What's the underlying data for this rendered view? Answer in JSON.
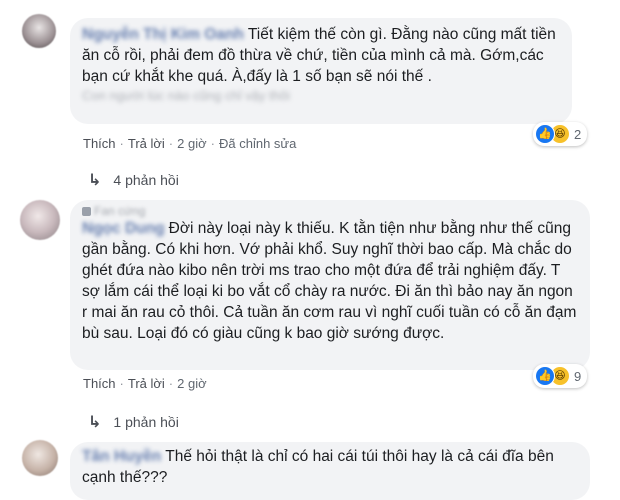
{
  "comments": [
    {
      "author": "Nguyễn Thị Kim Oanh",
      "badge": "",
      "text": "Tiết kiệm thế còn gì. Đằng nào cũng mất tiền ăn cỗ rồi, phải đem đồ thừa về chứ, tiền của mình cả mà. Gớm,các bạn cứ khắt khe quá. À,đấy là 1 số bạn sẽ nói thế .",
      "blurred_line": "Con người lúc nào cũng chỉ vậy thôi",
      "actions": {
        "like": "Thích",
        "reply": "Trả lời",
        "time": "2 giờ",
        "edited": "Đã chỉnh sửa"
      },
      "reaction_count": "2",
      "replies_label": "4 phản hồi"
    },
    {
      "author": "Ngọc Dung",
      "badge": "Fan cứng",
      "text": "Đời này loại này k thiếu. K tằn tiện như bằng như thế cũng gần bằng. Có khi hơn. Vớ phải khổ. Suy nghĩ thời bao cấp. Mà chắc do ghét đứa nào kibo nên trời ms trao cho một đứa để trải nghiệm đấy. T sợ lắm cái thể loại ki bo vắt cổ chày ra nước. Đi ăn thì bảo nay ăn ngon r mai ăn rau cỏ thôi. Cả tuần ăn cơm rau vì nghĩ cuối tuần có cỗ ăn đạm bù sau. Loại đó có giàu cũng k bao giờ sướng được.",
      "actions": {
        "like": "Thích",
        "reply": "Trả lời",
        "time": "2 giờ"
      },
      "reaction_count": "9",
      "replies_label": "1 phản hồi"
    },
    {
      "author": "Tân Huyền",
      "badge": "",
      "text": "Thế hỏi thật là chỉ có hai cái túi thôi hay là cả cái đĩa bên cạnh thế???"
    }
  ],
  "icons": {
    "like": "like-icon",
    "haha": "haha-icon",
    "reply_arrow": "reply-arrow-icon",
    "badge": "fan-badge-icon"
  },
  "colors": {
    "bubble": "#f2f3f5",
    "link": "#385898",
    "meta": "#606770",
    "like_blue": "#1877f2",
    "haha_yellow": "#f7c12a"
  }
}
